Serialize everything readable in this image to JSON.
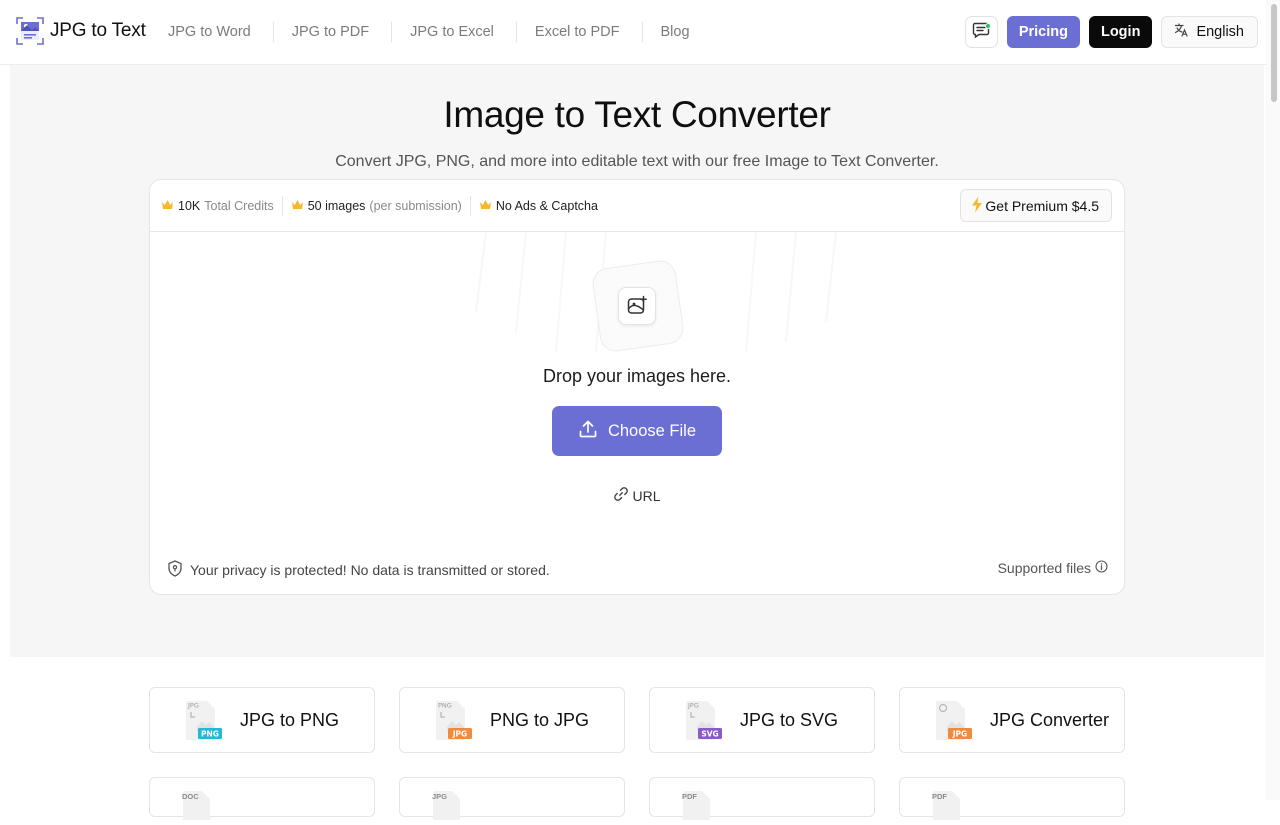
{
  "header": {
    "logo_text": "JPG to Text",
    "nav": [
      {
        "label": "JPG to Word"
      },
      {
        "label": "JPG to PDF"
      },
      {
        "label": "JPG to Excel"
      },
      {
        "label": "Excel to PDF"
      },
      {
        "label": "Blog"
      }
    ],
    "pricing_label": "Pricing",
    "login_label": "Login",
    "language_label": "English"
  },
  "hero": {
    "title": "Image to Text Converter",
    "subtitle": "Convert JPG, PNG, and more into editable text with our free Image to Text Converter."
  },
  "upload": {
    "features": [
      {
        "strong": "10K",
        "muted": "Total Credits"
      },
      {
        "strong": "50 images",
        "muted": "(per submission)"
      },
      {
        "strong": "No Ads & Captcha",
        "muted": ""
      }
    ],
    "premium_label": "Get Premium $4.5",
    "drop_text": "Drop your images here.",
    "choose_label": "Choose File",
    "url_label": "URL",
    "privacy_text": "Your privacy is protected! No data is transmitted or stored.",
    "supported_label": "Supported files"
  },
  "tools": [
    {
      "label": "JPG to PNG",
      "from": "JPG",
      "to": "PNG",
      "badge_color": "#22b8d6"
    },
    {
      "label": "PNG to JPG",
      "from": "PNG",
      "to": "JPG",
      "badge_color": "#f08a3c"
    },
    {
      "label": "JPG to SVG",
      "from": "JPG",
      "to": "SVG",
      "badge_color": "#8b5cc7"
    },
    {
      "label": "JPG Converter",
      "from": "",
      "to": "JPG",
      "badge_color": "#f08a3c"
    }
  ],
  "tools_row2": [
    {
      "tag": "DOC"
    },
    {
      "tag": "JPG"
    },
    {
      "tag": "PDF"
    },
    {
      "tag": "PDF"
    }
  ],
  "colors": {
    "accent": "#6b6fd4",
    "login_bg": "#0a0a0a",
    "crown": "#f5b82e",
    "premium_bolt": "#f5b82e",
    "online_dot": "#22c55e"
  }
}
